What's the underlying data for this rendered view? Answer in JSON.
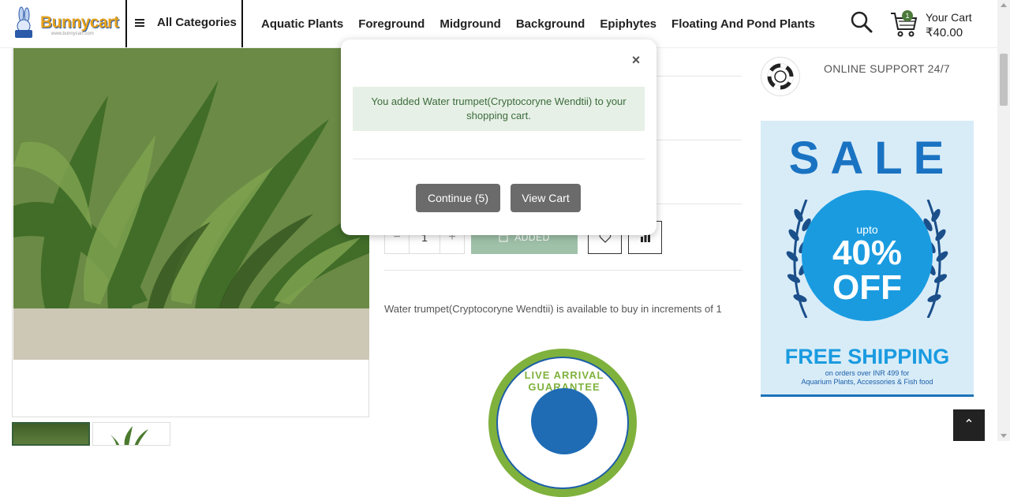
{
  "header": {
    "logo_text": "Bunnycart",
    "logo_sub": "www.bunnycart.com",
    "all_categories": "All Categories",
    "nav": [
      "Aquatic Plants",
      "Foreground",
      "Midground",
      "Background",
      "Epiphytes",
      "Floating And Pond Plants"
    ],
    "cart_count": "1",
    "cart_title": "Your Cart",
    "cart_total": "₹40.00"
  },
  "product": {
    "qty": "1",
    "added_label": "ADDED",
    "availability": "Water trumpet(Cryptocoryne Wendtii) is available to buy in increments of 1",
    "badge_text": "LIVE ARRIVAL GUARANTEE"
  },
  "sidebar": {
    "support": "ONLINE SUPPORT 24/7",
    "sale_title": "SALE",
    "sale_upto": "upto",
    "sale_pct": "40%",
    "sale_off": "OFF",
    "sale_ship": "FREE SHIPPING",
    "sale_sub1": "on orders over INR 499 for",
    "sale_sub2": "Aquarium Plants, Accessories & Fish food"
  },
  "modal": {
    "close": "×",
    "message": "You added Water trumpet(Cryptocoryne Wendtii) to your shopping cart.",
    "continue": "Continue (5)",
    "view_cart": "View Cart"
  },
  "colors": {
    "modal_success_bg": "#e6f0e6",
    "modal_button": "#6b6b6b",
    "added_button": "#9fc1a8",
    "sale_blue": "#1a73c2"
  }
}
